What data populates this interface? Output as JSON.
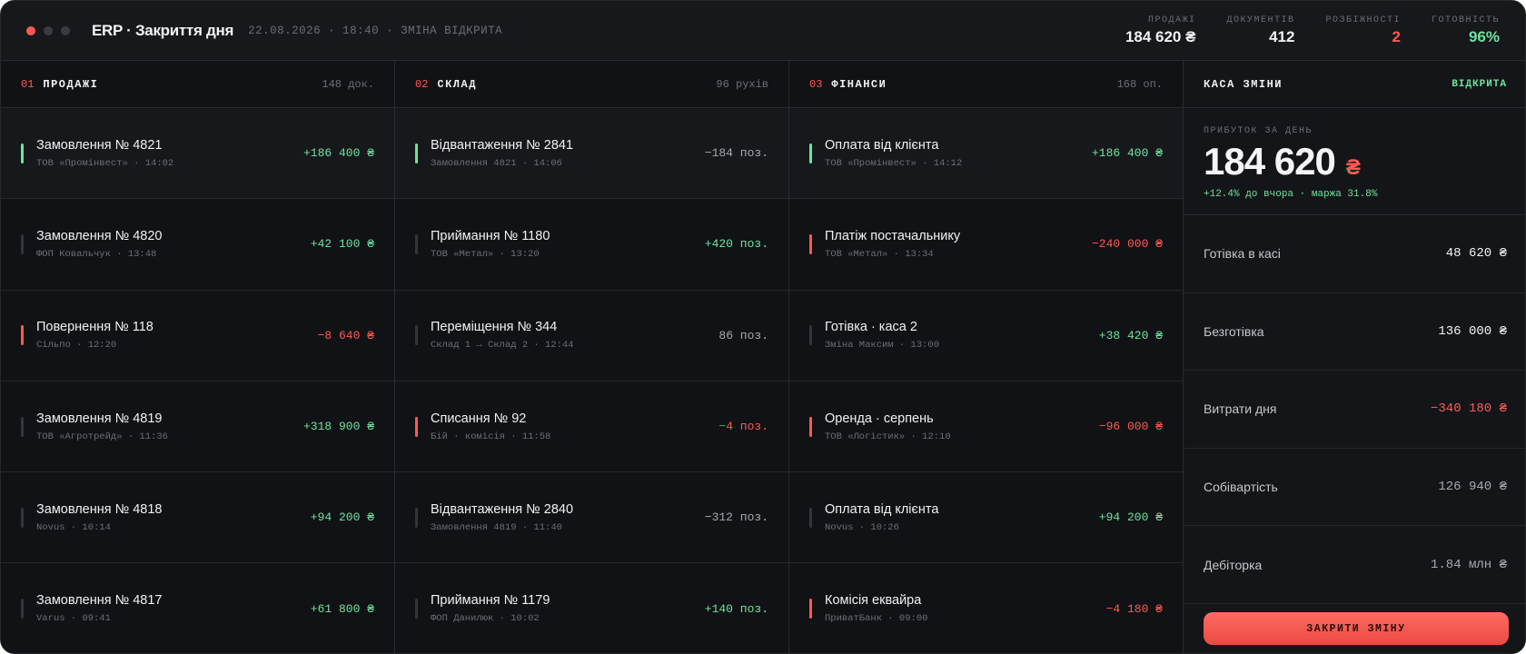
{
  "window": {
    "dots": [
      {
        "name": "close-dot",
        "color": "#ff5a52"
      },
      {
        "name": "minimize-dot",
        "color": "#3a3b40"
      },
      {
        "name": "maximize-dot",
        "color": "#3a3b40"
      }
    ]
  },
  "header": {
    "title": "ERP · Закриття дня",
    "subtitle": "22.08.2026 · 18:40 · ЗМІНА ВІДКРИТА",
    "stats": [
      {
        "label": "ПРОДАЖІ",
        "value": "184 620 ₴",
        "tone": ""
      },
      {
        "label": "ДОКУМЕНТІВ",
        "value": "412",
        "tone": ""
      },
      {
        "label": "РОЗБІЖНОСТІ",
        "value": "2",
        "tone": "red"
      },
      {
        "label": "ГОТОВНІСТЬ",
        "value": "96%",
        "tone": "green"
      }
    ]
  },
  "columns": [
    {
      "num": "01",
      "name": "ПРОДАЖІ",
      "count": "148 док.",
      "rows": [
        {
          "title": "Замовлення № 4821",
          "meta": "ТОВ «Промінвест» · 14:02",
          "value": "+186 400 ₴",
          "tone": "green",
          "bar": "green"
        },
        {
          "title": "Замовлення № 4820",
          "meta": "ФОП Ковальчук · 13:48",
          "value": "+42 100 ₴",
          "tone": "green",
          "bar": ""
        },
        {
          "title": "Повернення № 118",
          "meta": "Сільпо · 12:20",
          "value": "−8 640 ₴",
          "tone": "red",
          "bar": "red"
        },
        {
          "title": "Замовлення № 4819",
          "meta": "ТОВ «Агротрейд» · 11:36",
          "value": "+318 900 ₴",
          "tone": "green",
          "bar": ""
        },
        {
          "title": "Замовлення № 4818",
          "meta": "Novus · 10:14",
          "value": "+94 200 ₴",
          "tone": "green",
          "bar": ""
        },
        {
          "title": "Замовлення № 4817",
          "meta": "Varus · 09:41",
          "value": "+61 800 ₴",
          "tone": "green",
          "bar": ""
        }
      ]
    },
    {
      "num": "02",
      "name": "СКЛАД",
      "count": "96 рухів",
      "rows": [
        {
          "title": "Відвантаження № 2841",
          "meta": "Замовлення 4821 · 14:06",
          "value": "−184 поз.",
          "tone": "gray",
          "bar": "green"
        },
        {
          "title": "Приймання № 1180",
          "meta": "ТОВ «Метал» · 13:20",
          "value": "+420 поз.",
          "tone": "green",
          "bar": ""
        },
        {
          "title": "Переміщення № 344",
          "meta": "Склад 1 → Склад 2 · 12:44",
          "value": "86 поз.",
          "tone": "gray",
          "bar": ""
        },
        {
          "title": "Списання № 92",
          "meta": "Бій · комісія · 11:58",
          "value": "−4 поз.",
          "tone": "red",
          "bar": "red"
        },
        {
          "title": "Відвантаження № 2840",
          "meta": "Замовлення 4819 · 11:40",
          "value": "−312 поз.",
          "tone": "gray",
          "bar": ""
        },
        {
          "title": "Приймання № 1179",
          "meta": "ФОП Данилюк · 10:02",
          "value": "+140 поз.",
          "tone": "green",
          "bar": ""
        }
      ]
    },
    {
      "num": "03",
      "name": "ФІНАНСИ",
      "count": "168 оп.",
      "rows": [
        {
          "title": "Оплата від клієнта",
          "meta": "ТОВ «Промінвест» · 14:12",
          "value": "+186 400 ₴",
          "tone": "green",
          "bar": "green"
        },
        {
          "title": "Платіж постачальнику",
          "meta": "ТОВ «Метал» · 13:34",
          "value": "−240 000 ₴",
          "tone": "red",
          "bar": "red"
        },
        {
          "title": "Готівка · каса 2",
          "meta": "Зміна Максим · 13:00",
          "value": "+38 420 ₴",
          "tone": "green",
          "bar": ""
        },
        {
          "title": "Оренда · серпень",
          "meta": "ТОВ «Логістик» · 12:10",
          "value": "−96 000 ₴",
          "tone": "red",
          "bar": "red"
        },
        {
          "title": "Оплата від клієнта",
          "meta": "Novus · 10:26",
          "value": "+94 200 ₴",
          "tone": "green",
          "bar": ""
        },
        {
          "title": "Комісія еквайра",
          "meta": "ПриватБанк · 09:00",
          "value": "−4 180 ₴",
          "tone": "red",
          "bar": "red"
        }
      ]
    }
  ],
  "panel": {
    "title": "КАСА ЗМІНИ",
    "status": "ВІДКРИТА",
    "profit_label": "ПРИБУТОК ЗА ДЕНЬ",
    "profit_value": "184 620",
    "profit_currency": "₴",
    "profit_delta": "+12.4% до вчора · маржа 31.8%",
    "items": [
      {
        "label": "Готівка в касі",
        "value": "48 620 ₴",
        "tone": ""
      },
      {
        "label": "Безготівка",
        "value": "136 000 ₴",
        "tone": ""
      },
      {
        "label": "Витрати дня",
        "value": "−340 180 ₴",
        "tone": "red"
      },
      {
        "label": "Собівартість",
        "value": "126 940 ₴",
        "tone": "gray"
      },
      {
        "label": "Дебіторка",
        "value": "1.84 млн ₴",
        "tone": "gray"
      }
    ],
    "close_button": "ЗАКРИТИ ЗМІНУ"
  }
}
